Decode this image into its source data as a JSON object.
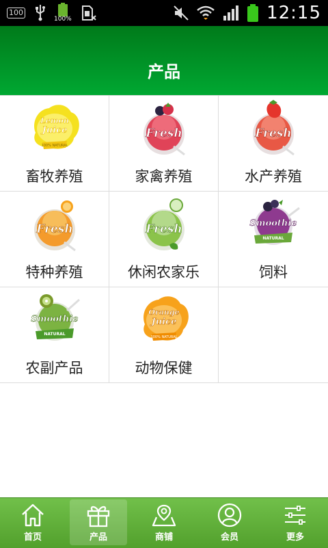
{
  "status_bar": {
    "badge": "100",
    "battery_small_pct": "100%",
    "time": "12:15",
    "icons": [
      "100-badge-icon",
      "usb-icon",
      "battery-icon",
      "sim-icon",
      "mute-icon",
      "wifi-icon",
      "signal-icon",
      "battery-full-icon"
    ]
  },
  "header": {
    "title": "产品"
  },
  "categories": [
    {
      "label": "畜牧养殖",
      "art": "lemon-juice-label-icon",
      "badge_text": "Lemon Juice",
      "color": "#f2d21b"
    },
    {
      "label": "家禽养殖",
      "art": "fresh-raspberry-label-icon",
      "badge_text": "Fresh",
      "color": "#e04358"
    },
    {
      "label": "水产养殖",
      "art": "fresh-strawberry-label-icon",
      "badge_text": "Fresh",
      "color": "#e85845"
    },
    {
      "label": "特种养殖",
      "art": "fresh-orange-label-icon",
      "badge_text": "Fresh",
      "color": "#f49b2c"
    },
    {
      "label": "休闲农家乐",
      "art": "fresh-cucumber-label-icon",
      "badge_text": "Fresh",
      "color": "#8bc34a"
    },
    {
      "label": "饲料",
      "art": "smoothie-blueberry-label-icon",
      "badge_text": "Smoothie",
      "color": "#8e3a8f"
    },
    {
      "label": "农副产品",
      "art": "smoothie-kiwi-label-icon",
      "badge_text": "Smoothie",
      "color": "#7cb342"
    },
    {
      "label": "动物保健",
      "art": "orange-juice-label-icon",
      "badge_text": "Orange Juice",
      "color": "#f7a21b"
    }
  ],
  "nav": {
    "items": [
      {
        "label": "首页",
        "icon": "home-icon"
      },
      {
        "label": "产品",
        "icon": "gift-icon"
      },
      {
        "label": "商铺",
        "icon": "map-pin-icon"
      },
      {
        "label": "会员",
        "icon": "user-icon"
      },
      {
        "label": "更多",
        "icon": "sliders-icon"
      }
    ],
    "active": "产品"
  }
}
